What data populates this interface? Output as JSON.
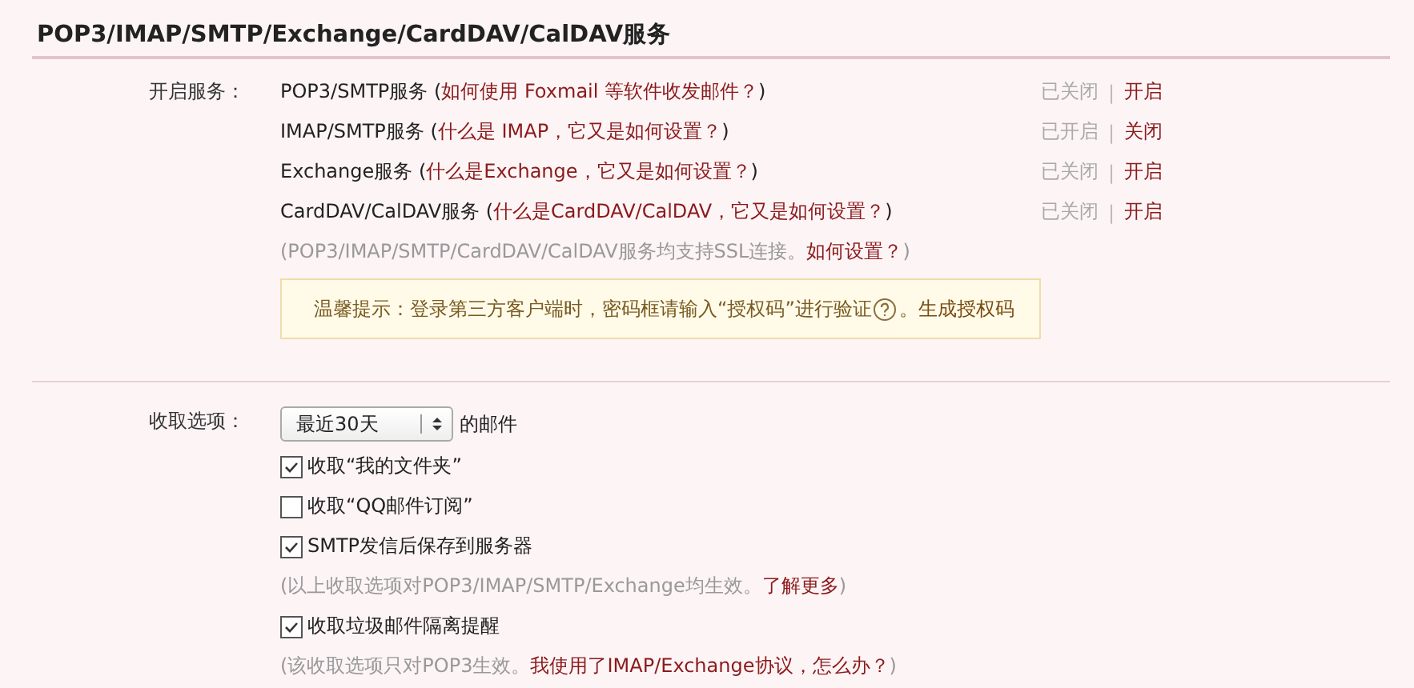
{
  "title": "POP3/IMAP/SMTP/Exchange/CardDAV/CalDAV服务",
  "services_label": "开启服务：",
  "services": [
    {
      "name": "POP3/SMTP服务 (",
      "link": "如何使用 Foxmail 等软件收发邮件？",
      "close": ")",
      "status": "已关闭",
      "separator": "|",
      "action": "开启"
    },
    {
      "name": "IMAP/SMTP服务 (",
      "link": "什么是 IMAP，它又是如何设置？",
      "close": ")",
      "status": "已开启",
      "separator": "|",
      "action": "关闭"
    },
    {
      "name": "Exchange服务 (",
      "link": "什么是Exchange，它又是如何设置？",
      "close": ")",
      "status": "已关闭",
      "separator": "|",
      "action": "开启"
    },
    {
      "name": "CardDAV/CalDAV服务 (",
      "link": "什么是CardDAV/CalDAV，它又是如何设置？",
      "close": ")",
      "status": "已关闭",
      "separator": "|",
      "action": "开启"
    }
  ],
  "ssl_note": {
    "text": "(POP3/IMAP/SMTP/CardDAV/CalDAV服务均支持SSL连接。",
    "link": "如何设置？",
    "close": ")"
  },
  "tip": {
    "text": "温馨提示：登录第三方客户端时，密码框请输入“授权码”进行验证",
    "end": "。",
    "link": "生成授权码"
  },
  "receive_label": "收取选项：",
  "period": {
    "value": "最近30天",
    "suffix": "的邮件"
  },
  "options": [
    {
      "kind": "checkbox",
      "label": "收取“我的文件夹”",
      "checked": true
    },
    {
      "kind": "checkbox",
      "label": "收取“QQ邮件订阅”",
      "checked": false
    },
    {
      "kind": "checkbox",
      "label": "SMTP发信后保存到服务器",
      "checked": true
    },
    {
      "kind": "note",
      "text": "(以上收取选项对POP3/IMAP/SMTP/Exchange均生效。",
      "link": "了解更多",
      "close": ")"
    },
    {
      "kind": "checkbox",
      "label": "收取垃圾邮件隔离提醒",
      "checked": true
    },
    {
      "kind": "note",
      "text": "(该收取选项只对POP3生效。",
      "link": "我使用了IMAP/Exchange协议，怎么办？",
      "close": ")"
    }
  ]
}
